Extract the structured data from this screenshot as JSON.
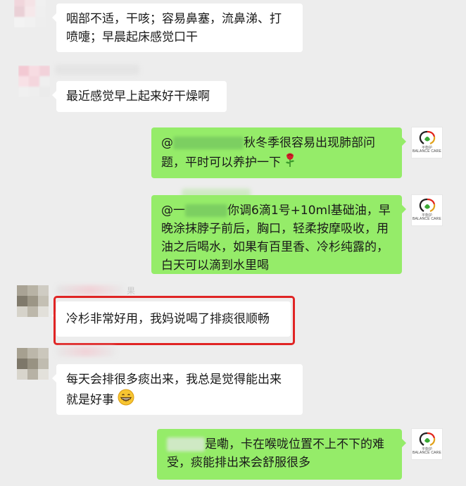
{
  "messages": [
    {
      "side": "left",
      "text": "咽部不适，干咳；容易鼻塞，流鼻涕、打喷嚏；早晨起床感觉口干"
    },
    {
      "side": "left",
      "text": "最近感觉早上起来好干燥啊"
    },
    {
      "side": "right",
      "prefix": "@",
      "text": "秋冬季很容易出现肺部问题，平时可以养护一下",
      "emoji": "rose-icon"
    },
    {
      "side": "right",
      "prefix": "@一",
      "text": "你调6滴1号+10ml基础油，早晚涂抹脖子前后，胸口，轻柔按摩吸收，用油之后喝水，如果有百里香、冷杉纯露的，白天可以滴到水里喝"
    },
    {
      "side": "left",
      "text": "冷杉非常好用，我妈说喝了排痰很顺畅",
      "highlighted": true
    },
    {
      "side": "left",
      "text": "每天会排很多痰出来，我总是觉得能出来就是好事",
      "emoji": "grin-icon"
    },
    {
      "side": "right",
      "text": "是嘞，卡在喉咙位置不上不下的难受，痰能排出来会舒服很多"
    }
  ],
  "brand": {
    "name_en": "BALANCE CARE",
    "name_cn": "平衡护"
  },
  "sender_label_fragment": "果",
  "colors": {
    "background": "#ededed",
    "outgoing": "#95ec69",
    "incoming": "#ffffff",
    "highlight": "#e02424"
  }
}
